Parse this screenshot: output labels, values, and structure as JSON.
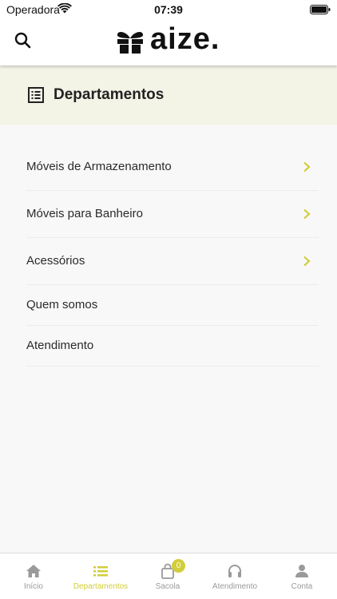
{
  "status_bar": {
    "carrier": "Operadora",
    "time": "07:39"
  },
  "header": {
    "logo_text": "aize."
  },
  "section": {
    "title": "Departamentos"
  },
  "menu": {
    "items": [
      {
        "label": "Móveis de Armazenamento",
        "has_chevron": true
      },
      {
        "label": "Móveis para Banheiro",
        "has_chevron": true
      },
      {
        "label": "Acessórios",
        "has_chevron": true
      },
      {
        "label": "Quem somos",
        "has_chevron": false
      },
      {
        "label": "Atendimento",
        "has_chevron": false
      }
    ]
  },
  "tab_bar": {
    "tabs": [
      {
        "label": "Início",
        "icon": "home-icon",
        "active": false
      },
      {
        "label": "Departamentos",
        "icon": "list-icon",
        "active": true
      },
      {
        "label": "Sacola",
        "icon": "bag-icon",
        "active": false,
        "badge": "0"
      },
      {
        "label": "Atendimento",
        "icon": "headphones-icon",
        "active": false
      },
      {
        "label": "Conta",
        "icon": "person-icon",
        "active": false
      }
    ]
  },
  "colors": {
    "accent": "#d2cd3a",
    "band": "#f3f3e6",
    "inactive": "#9a9a9a"
  }
}
